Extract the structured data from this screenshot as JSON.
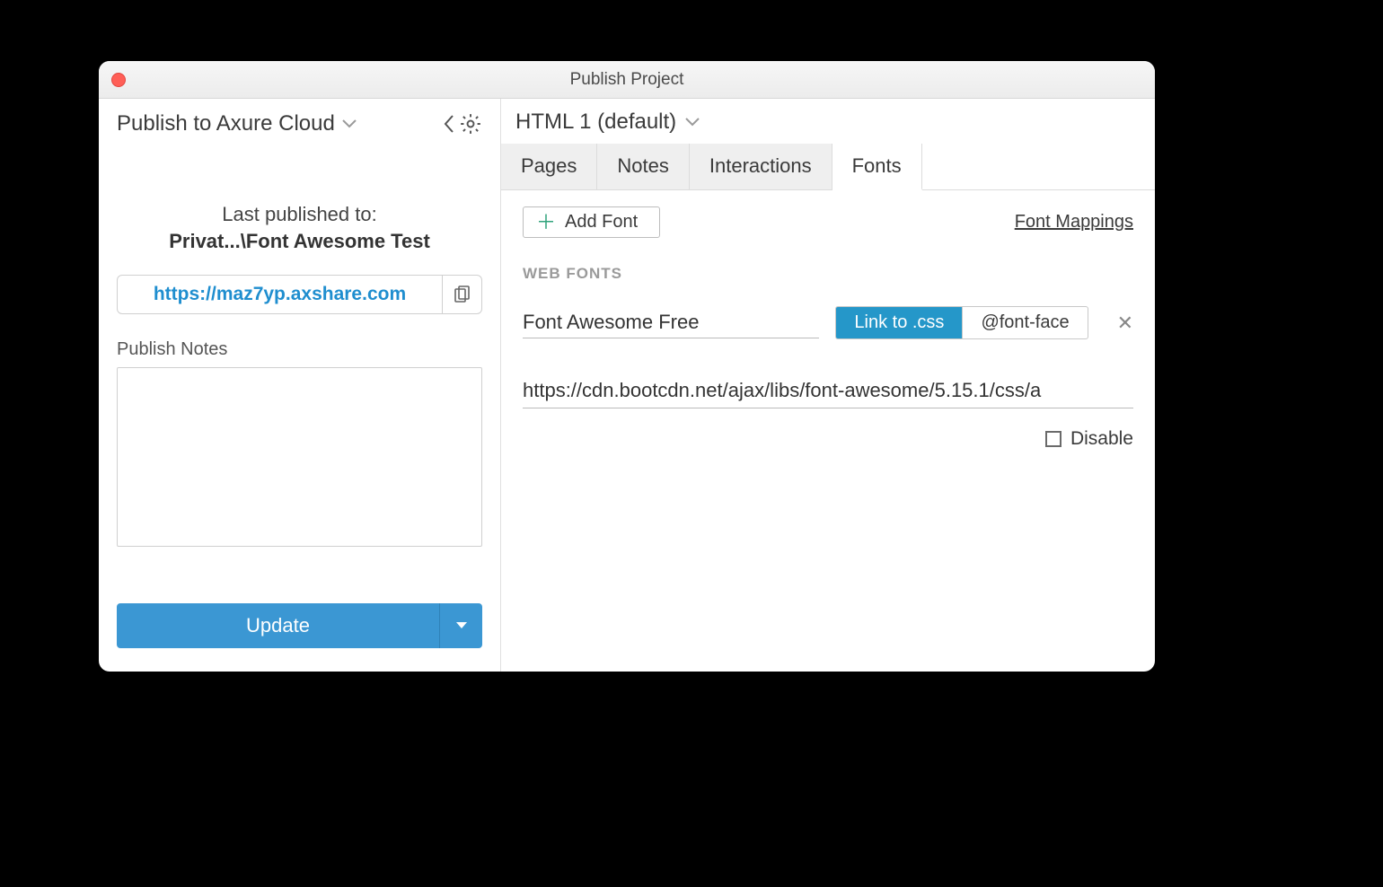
{
  "window": {
    "title": "Publish Project"
  },
  "left": {
    "header": "Publish to Axure Cloud",
    "last_published_label": "Last published to:",
    "project_name": "Privat...\\Font Awesome Test",
    "url": "https://maz7yp.axshare.com",
    "publish_notes_label": "Publish Notes",
    "publish_notes_value": "",
    "update_label": "Update"
  },
  "right": {
    "config_name": "HTML 1 (default)",
    "tabs": [
      "Pages",
      "Notes",
      "Interactions",
      "Fonts"
    ],
    "active_tab": "Fonts",
    "add_font_label": "Add Font",
    "font_mappings_label": "Font Mappings",
    "web_fonts_label": "WEB FONTS",
    "font_entry": {
      "name": "Font Awesome Free",
      "mode_link": "Link to .css",
      "mode_face": "@font-face",
      "url": "https://cdn.bootcdn.net/ajax/libs/font-awesome/5.15.1/css/a",
      "disable_label": "Disable",
      "disabled": false
    }
  }
}
